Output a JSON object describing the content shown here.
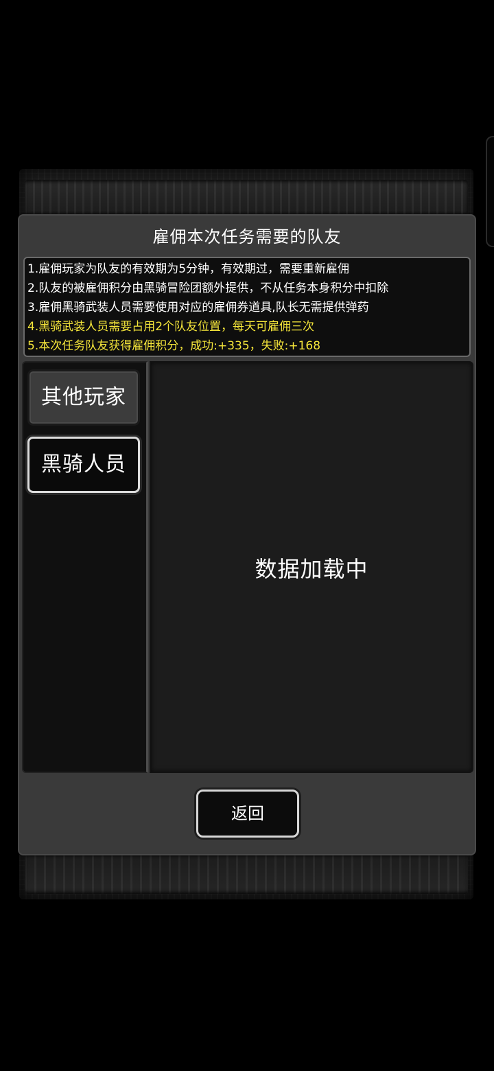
{
  "dialog": {
    "title": "雇佣本次任务需要的队友"
  },
  "rules": [
    {
      "text": "1.雇佣玩家为队友的有效期为5分钟，有效期过，需要重新雇佣",
      "highlight": false
    },
    {
      "text": "2.队友的被雇佣积分由黑骑冒险团额外提供，不从任务本身积分中扣除",
      "highlight": false
    },
    {
      "text": "3.雇佣黑骑武装人员需要使用对应的雇佣券道具,队长无需提供弹药",
      "highlight": false
    },
    {
      "text": "4.黑骑武装人员需要占用2个队友位置，每天可雇佣三次",
      "highlight": true
    },
    {
      "text": "5.本次任务队友获得雇佣积分，成功:+335，失败:+168",
      "highlight": true
    }
  ],
  "tabs": {
    "other_players": "其他玩家",
    "black_knight_staff": "黑骑人员",
    "selected": "black_knight_staff"
  },
  "content": {
    "loading_text": "数据加载中"
  },
  "footer": {
    "back_label": "返回"
  },
  "colors": {
    "highlight_text": "#f5e63a",
    "dialog_bg": "#3a3a3a",
    "page_bg": "#000000"
  }
}
